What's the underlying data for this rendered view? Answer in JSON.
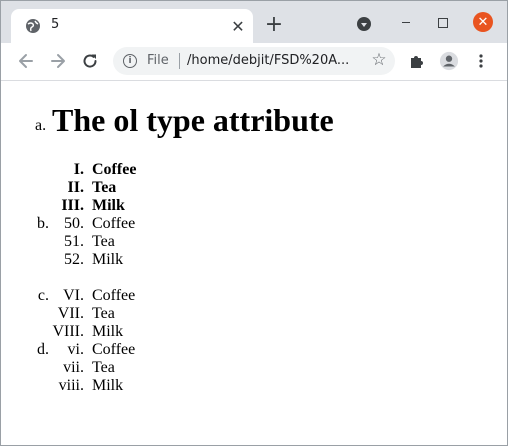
{
  "browser": {
    "tab_title": "5",
    "tab_close_glyph": "✕",
    "new_tab_glyph": "+",
    "close_glyph": "✕",
    "scheme_label": "File",
    "url": "/home/debjit/FSD%20A...",
    "accent_close": "#e95420"
  },
  "page": {
    "heading_marker": "a.",
    "heading": "The ol type attribute",
    "list_b_marker": "b.",
    "list_c_marker": "c.",
    "list_d_marker": "d.",
    "list_bold": [
      {
        "num": "I.",
        "text": "Coffee"
      },
      {
        "num": "II.",
        "text": "Tea"
      },
      {
        "num": "III.",
        "text": "Milk"
      }
    ],
    "list_b": [
      {
        "num": "50.",
        "text": "Coffee"
      },
      {
        "num": "51.",
        "text": "Tea"
      },
      {
        "num": "52.",
        "text": "Milk"
      }
    ],
    "list_c": [
      {
        "num": "VI.",
        "text": "Coffee"
      },
      {
        "num": "VII.",
        "text": "Tea"
      },
      {
        "num": "VIII.",
        "text": "Milk"
      }
    ],
    "list_d": [
      {
        "num": "vi.",
        "text": "Coffee"
      },
      {
        "num": "vii.",
        "text": "Tea"
      },
      {
        "num": "viii.",
        "text": "Milk"
      }
    ]
  }
}
